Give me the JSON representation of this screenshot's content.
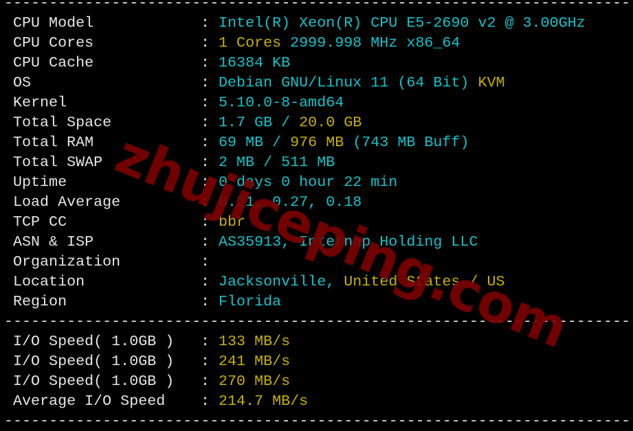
{
  "separator": "----------------------------------------------------------------------",
  "sys_rows": [
    {
      "label": "CPU Model",
      "segs": [
        {
          "t": "Intel(R) Xeon(R) CPU E5-2690 v2 @ 3.00GHz",
          "c": "c"
        }
      ]
    },
    {
      "label": "CPU Cores",
      "segs": [
        {
          "t": "1 Cores ",
          "c": "y"
        },
        {
          "t": "2999.998 MHz x86_64",
          "c": "c"
        }
      ]
    },
    {
      "label": "CPU Cache",
      "segs": [
        {
          "t": "16384 KB",
          "c": "c"
        }
      ]
    },
    {
      "label": "OS",
      "segs": [
        {
          "t": "Debian GNU/Linux 11 (64 Bit) ",
          "c": "c"
        },
        {
          "t": "KVM",
          "c": "y"
        }
      ]
    },
    {
      "label": "Kernel",
      "segs": [
        {
          "t": "5.10.0-8-amd64",
          "c": "c"
        }
      ]
    },
    {
      "label": "Total Space",
      "segs": [
        {
          "t": "1.7 GB / ",
          "c": "c"
        },
        {
          "t": "20.0 GB",
          "c": "y"
        }
      ]
    },
    {
      "label": "Total RAM",
      "segs": [
        {
          "t": "69 MB / ",
          "c": "c"
        },
        {
          "t": "976 MB",
          "c": "y"
        },
        {
          "t": " (743 MB Buff)",
          "c": "c"
        }
      ]
    },
    {
      "label": "Total SWAP",
      "segs": [
        {
          "t": "2 MB / 511 MB",
          "c": "c"
        }
      ]
    },
    {
      "label": "Uptime",
      "segs": [
        {
          "t": "0 days 0 hour 22 min",
          "c": "c"
        }
      ]
    },
    {
      "label": "Load Average",
      "segs": [
        {
          "t": "0.21, 0.27, 0.18",
          "c": "c"
        }
      ]
    },
    {
      "label": "TCP CC",
      "segs": [
        {
          "t": "bbr",
          "c": "y"
        }
      ]
    },
    {
      "label": "ASN & ISP",
      "segs": [
        {
          "t": "AS35913, Internap Holding LLC",
          "c": "c"
        }
      ]
    },
    {
      "label": "Organization",
      "segs": []
    },
    {
      "label": "Location",
      "segs": [
        {
          "t": "Jacksonville, ",
          "c": "c"
        },
        {
          "t": "United States / US",
          "c": "y"
        }
      ]
    },
    {
      "label": "Region",
      "segs": [
        {
          "t": "Florida",
          "c": "c"
        }
      ]
    }
  ],
  "io_rows": [
    {
      "label": "I/O Speed( 1.0GB )",
      "segs": [
        {
          "t": "133 MB/s",
          "c": "y"
        }
      ]
    },
    {
      "label": "I/O Speed( 1.0GB )",
      "segs": [
        {
          "t": "241 MB/s",
          "c": "y"
        }
      ]
    },
    {
      "label": "I/O Speed( 1.0GB )",
      "segs": [
        {
          "t": "270 MB/s",
          "c": "y"
        }
      ]
    },
    {
      "label": "Average I/O Speed",
      "segs": [
        {
          "t": "214.7 MB/s",
          "c": "y"
        }
      ]
    }
  ],
  "colon": ": ",
  "watermark": "zhujiceping.com",
  "colors": {
    "cyan": "#10c4cc",
    "yellow": "#c8b000",
    "text": "#e6e6e6",
    "background": "#000000",
    "watermark": "#7e0000"
  }
}
